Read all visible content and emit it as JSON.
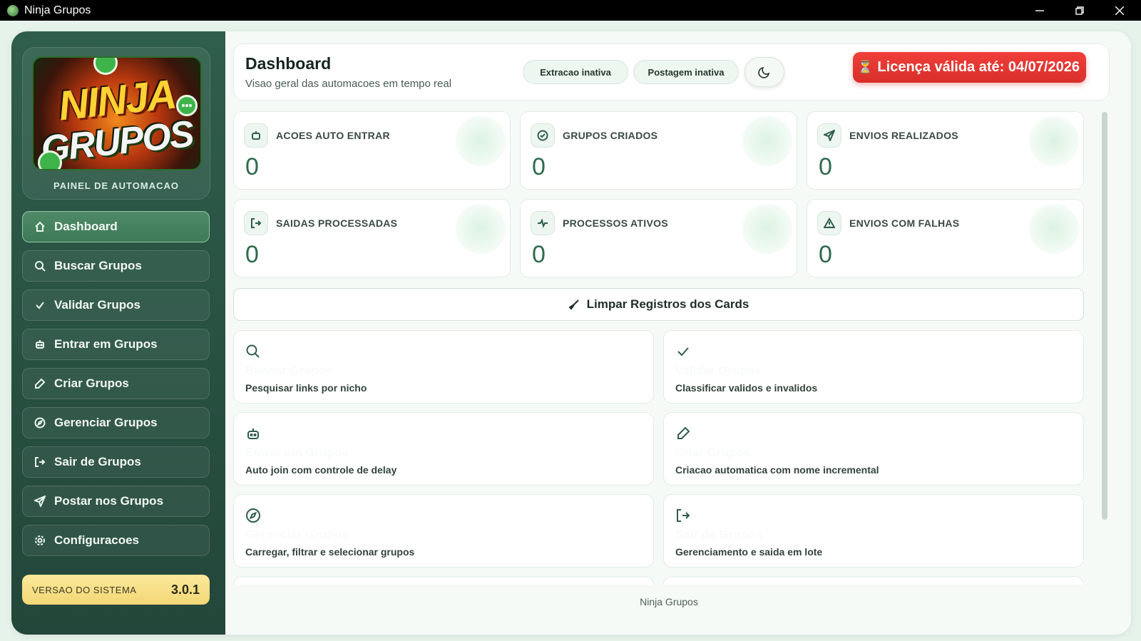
{
  "window": {
    "title": "Ninja Grupos"
  },
  "brand": {
    "logo_line1": "NINJA",
    "logo_line2": "GRUPOS",
    "subtitle": "PAINEL DE AUTOMACAO"
  },
  "sidebar": {
    "items": [
      {
        "label": "Dashboard",
        "icon": "home-icon",
        "active": true
      },
      {
        "label": "Buscar Grupos",
        "icon": "search-icon"
      },
      {
        "label": "Validar Grupos",
        "icon": "check-icon"
      },
      {
        "label": "Entrar em Grupos",
        "icon": "robot-icon"
      },
      {
        "label": "Criar Grupos",
        "icon": "pen-icon"
      },
      {
        "label": "Gerenciar Grupos",
        "icon": "compass-icon"
      },
      {
        "label": "Sair de Grupos",
        "icon": "logout-icon"
      },
      {
        "label": "Postar nos Grupos",
        "icon": "send-icon"
      },
      {
        "label": "Configuracoes",
        "icon": "gear-icon"
      }
    ],
    "version": {
      "label": "VERSAO DO SISTEMA",
      "value": "3.0.1"
    }
  },
  "header": {
    "title": "Dashboard",
    "subtitle": "Visao geral das automacoes em tempo real",
    "status_extraction": "Extracao inativa",
    "status_posting": "Postagem inativa",
    "theme_toggle_icon": "moon-icon",
    "license": "Licença válida até: 04/07/2026",
    "license_icon": "hourglass-icon"
  },
  "stats": [
    {
      "label": "ACOES AUTO ENTRAR",
      "value": "0",
      "icon": "robot-icon"
    },
    {
      "label": "GRUPOS CRIADOS",
      "value": "0",
      "icon": "check-circle-icon"
    },
    {
      "label": "ENVIOS REALIZADOS",
      "value": "0",
      "icon": "send-icon"
    },
    {
      "label": "SAIDAS PROCESSADAS",
      "value": "0",
      "icon": "logout-icon"
    },
    {
      "label": "PROCESSOS ATIVOS",
      "value": "0",
      "icon": "activity-icon"
    },
    {
      "label": "ENVIOS COM FALHAS",
      "value": "0",
      "icon": "warning-icon"
    }
  ],
  "clear_button": "Limpar Registros dos Cards",
  "features": [
    {
      "title": "Buscar Grupos",
      "desc": "Pesquisar links por nicho",
      "icon": "search-icon"
    },
    {
      "title": "Validar Grupos",
      "desc": "Classificar validos e invalidos",
      "icon": "check-icon"
    },
    {
      "title": "Entrar em Grupos",
      "desc": "Auto join com controle de delay",
      "icon": "robot-icon"
    },
    {
      "title": "Criar Grupos",
      "desc": "Criacao automatica com nome incremental",
      "icon": "pen-icon"
    },
    {
      "title": "Gerenciar Grupos",
      "desc": "Carregar, filtrar e selecionar grupos",
      "icon": "compass-icon"
    },
    {
      "title": "Sair de Grupos",
      "desc": "Gerenciamento e saida em lote",
      "icon": "logout-icon"
    }
  ],
  "footer": "Ninja Grupos",
  "colors": {
    "sidebar": "#2f5e4c",
    "accent": "#2f6b4c",
    "license": "#e5332e",
    "version": "#f6dd82"
  }
}
